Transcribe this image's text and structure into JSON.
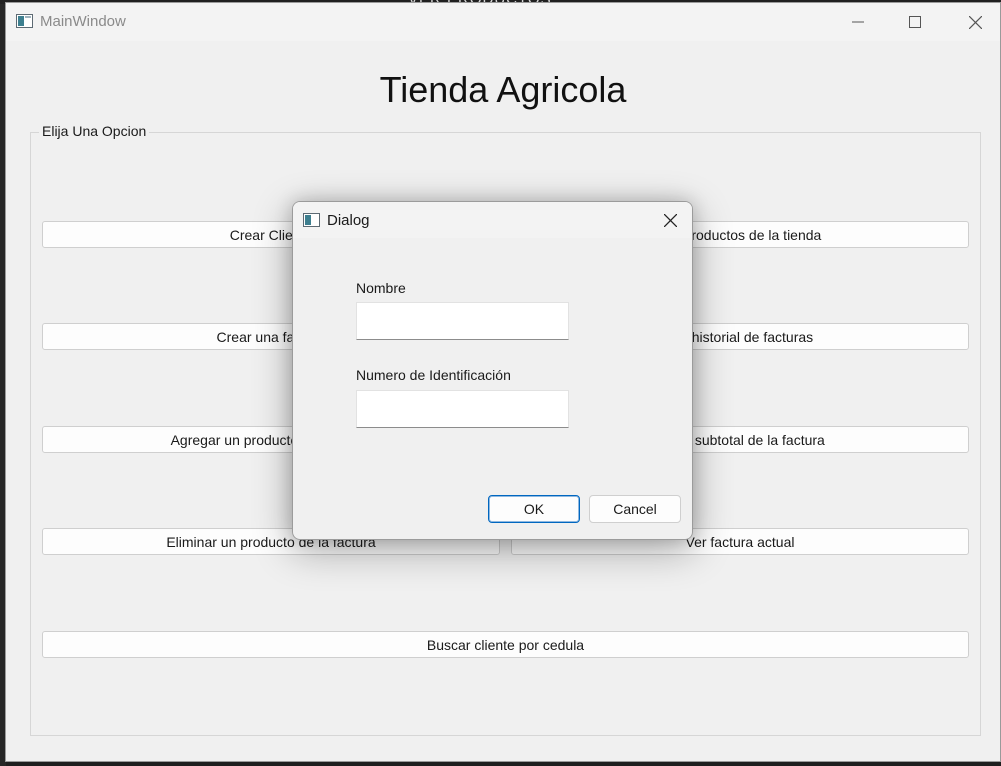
{
  "background": {
    "behind_text": "VER PRODUCTOS"
  },
  "main_window": {
    "title": "MainWindow",
    "heading": "Tienda Agricola",
    "group_title": "Elija Una Opcion",
    "buttons": [
      {
        "label": "Crear Cliente"
      },
      {
        "label": "Ver productos de la tienda"
      },
      {
        "label": "Crear una factura"
      },
      {
        "label": "Ver historial de facturas"
      },
      {
        "label": "Agregar un producto a la factura"
      },
      {
        "label": "Ver el subtotal de la factura"
      },
      {
        "label": "Eliminar un producto de la factura"
      },
      {
        "label": "Ver factura actual"
      },
      {
        "label": "Buscar cliente por cedula"
      }
    ]
  },
  "dialog": {
    "title": "Dialog",
    "fields": [
      {
        "label": "Nombre",
        "value": ""
      },
      {
        "label": "Numero de Identificación",
        "value": ""
      }
    ],
    "ok_label": "OK",
    "cancel_label": "Cancel"
  },
  "icons": {
    "minimize": "minimize-icon",
    "maximize": "maximize-icon",
    "close": "close-icon",
    "app": "app-window-icon"
  },
  "colors": {
    "window_bg": "#f0f0f0",
    "accent": "#0067c0",
    "text": "#1a1a1a"
  }
}
